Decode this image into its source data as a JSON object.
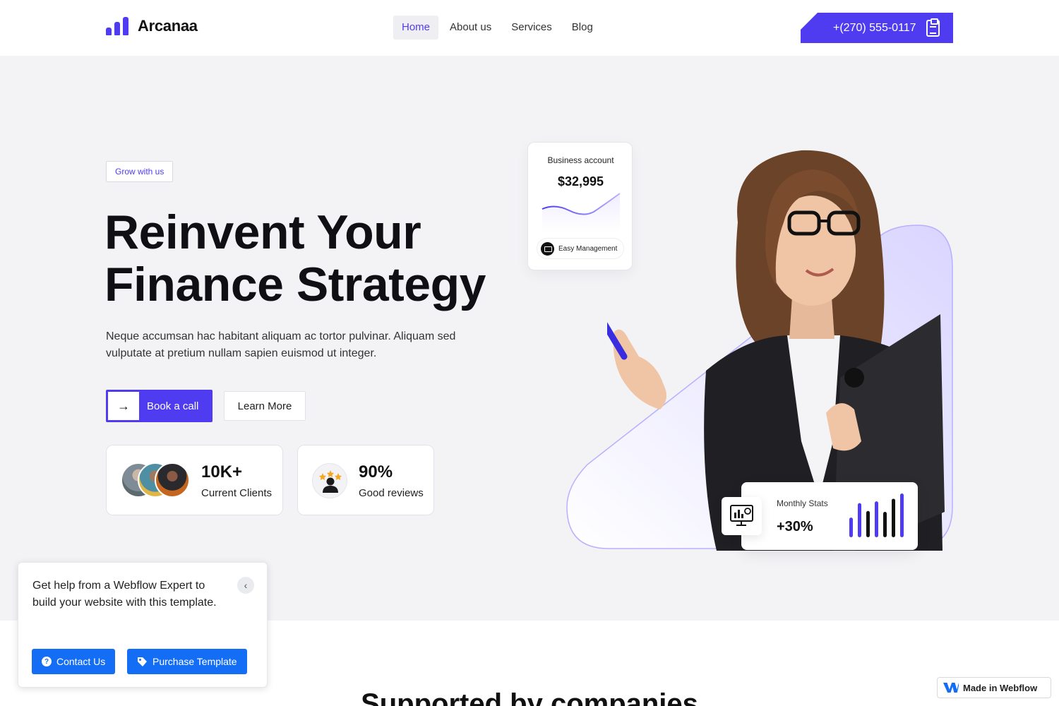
{
  "brand": {
    "name": "Arcanaa",
    "accent": "#4f3cf0"
  },
  "nav": {
    "links": [
      {
        "label": "Home",
        "active": true
      },
      {
        "label": "About us"
      },
      {
        "label": "Services"
      },
      {
        "label": "Blog"
      }
    ],
    "phone": "+(270) 555-0117",
    "phone_icon": "clipboard-icon"
  },
  "hero": {
    "badge": "Grow with us",
    "title_line1": "Reinvent Your",
    "title_line2": "Finance Strategy",
    "text": "Neque accumsan hac habitant aliquam ac tortor pulvinar. Aliquam sed vulputate at pretium nullam sapien euismod ut integer.",
    "primary_cta": "Book a call",
    "secondary_cta": "Learn More",
    "stats": [
      {
        "value": "10K+",
        "label": "Current Clients"
      },
      {
        "value": "90%",
        "label": "Good reviews"
      }
    ]
  },
  "business_card": {
    "title": "Business account",
    "value": "$32,995",
    "tag": "Easy Management"
  },
  "monthly_card": {
    "title": "Monthly Stats",
    "value": "+30%",
    "bar_levels": [
      0.45,
      0.78,
      0.6,
      0.82,
      0.58,
      0.88,
      1.0
    ],
    "bar_colors": [
      "#4f3cf0",
      "#4f3cf0",
      "#111111",
      "#4f3cf0",
      "#111111",
      "#111111",
      "#4f3cf0"
    ]
  },
  "section_heading": "Supported by companies",
  "help_popup": {
    "text": "Get help from a Webflow Expert to build your website with this template.",
    "contact": "Contact Us",
    "purchase": "Purchase Template"
  },
  "webflow_badge": "Made in Webflow"
}
